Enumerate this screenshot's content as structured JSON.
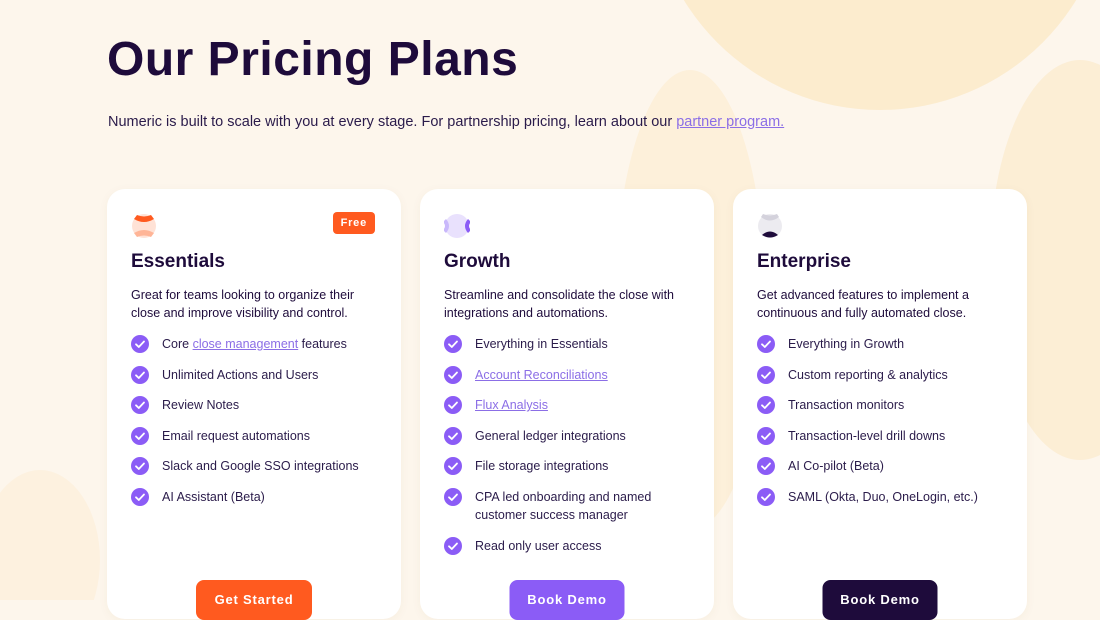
{
  "header": {
    "title": "Our Pricing Plans",
    "subtitle_text": "Numeric is built to scale with you at every stage. For partnership pricing, learn about our ",
    "partner_link": "partner program."
  },
  "colors": {
    "accent_orange": "#ff5a1f",
    "accent_purple": "#8b5cf6",
    "dark_navy": "#1e0b3b",
    "link_purple": "#8b6ee6",
    "background": "#fdf6ec"
  },
  "plans": [
    {
      "name": "Essentials",
      "badge": "Free",
      "logo_icon": "essentials-logo-icon",
      "description": "Great for teams looking to organize their close and improve visibility and control.",
      "features": {
        "f0_prefix": "Core ",
        "f0_link": "close management",
        "f0_suffix": " features",
        "f1": "Unlimited Actions and Users",
        "f2": "Review Notes",
        "f3": "Email request automations",
        "f4": "Slack and Google SSO integrations",
        "f5": "AI Assistant (Beta)"
      },
      "cta": "Get Started"
    },
    {
      "name": "Growth",
      "logo_icon": "growth-logo-icon",
      "description": "Streamline and consolidate the close with integrations and automations.",
      "features": {
        "f0": "Everything in Essentials",
        "f1_link": "Account Reconciliations",
        "f2_link": "Flux Analysis",
        "f3": "General ledger integrations",
        "f4": "File storage integrations",
        "f5": "CPA led onboarding and named customer success manager",
        "f6": "Read only user access"
      },
      "cta": "Book Demo"
    },
    {
      "name": "Enterprise",
      "logo_icon": "enterprise-logo-icon",
      "description": "Get advanced features to implement a continuous and fully automated close.",
      "features": {
        "f0": "Everything in Growth",
        "f1": "Custom reporting & analytics",
        "f2": "Transaction monitors",
        "f3": "Transaction-level drill downs",
        "f4": "AI Co-pilot (Beta)",
        "f5": "SAML (Okta, Duo, OneLogin, etc.)"
      },
      "cta": "Book Demo"
    }
  ]
}
